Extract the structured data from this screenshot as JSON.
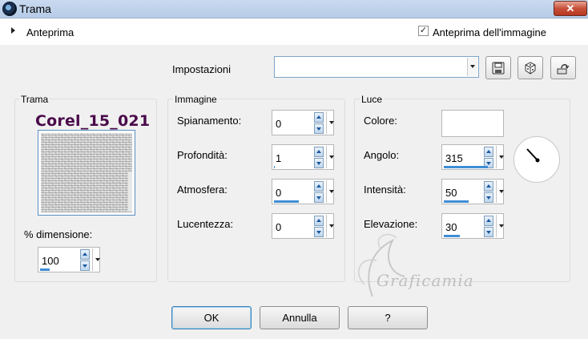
{
  "window": {
    "title": "Trama",
    "close_label": "✕"
  },
  "preview": {
    "label": "Anteprima",
    "image_preview_label": "Anteprima dell'immagine",
    "image_preview_checked": true
  },
  "settings": {
    "label": "Impostazioni",
    "value": ""
  },
  "tools": [
    "save-icon",
    "random-icon",
    "reset-icon"
  ],
  "texture": {
    "group_title": "Trama",
    "name": "Corel_15_021",
    "size_label": "% dimensione:",
    "size_value": "100",
    "size_fill": 0.2
  },
  "image": {
    "group_title": "Immagine",
    "fields": [
      {
        "label": "Spianamento:",
        "value": "0",
        "fill": 0.0
      },
      {
        "label": "Profondità:",
        "value": "1",
        "fill": 0.02
      },
      {
        "label": "Atmosfera:",
        "value": "0",
        "fill": 0.5
      },
      {
        "label": "Lucentezza:",
        "value": "0",
        "fill": 0.0
      }
    ]
  },
  "light": {
    "group_title": "Luce",
    "color_label": "Colore:",
    "color": "#ffffff",
    "angle_label": "Angolo:",
    "angle": "315",
    "angle_fill": 0.88,
    "intensity_label": "Intensità:",
    "intensity": "50",
    "intensity_fill": 0.5,
    "elevation_label": "Elevazione:",
    "elevation": "30",
    "elevation_fill": 0.33
  },
  "buttons": {
    "ok": "OK",
    "cancel": "Annulla",
    "help": "?"
  },
  "watermark": {
    "text": "Graficamia"
  },
  "colors": {
    "texture_name": "#4a0a4a",
    "accent": "#3f8ed6",
    "close": "#c7503a"
  }
}
